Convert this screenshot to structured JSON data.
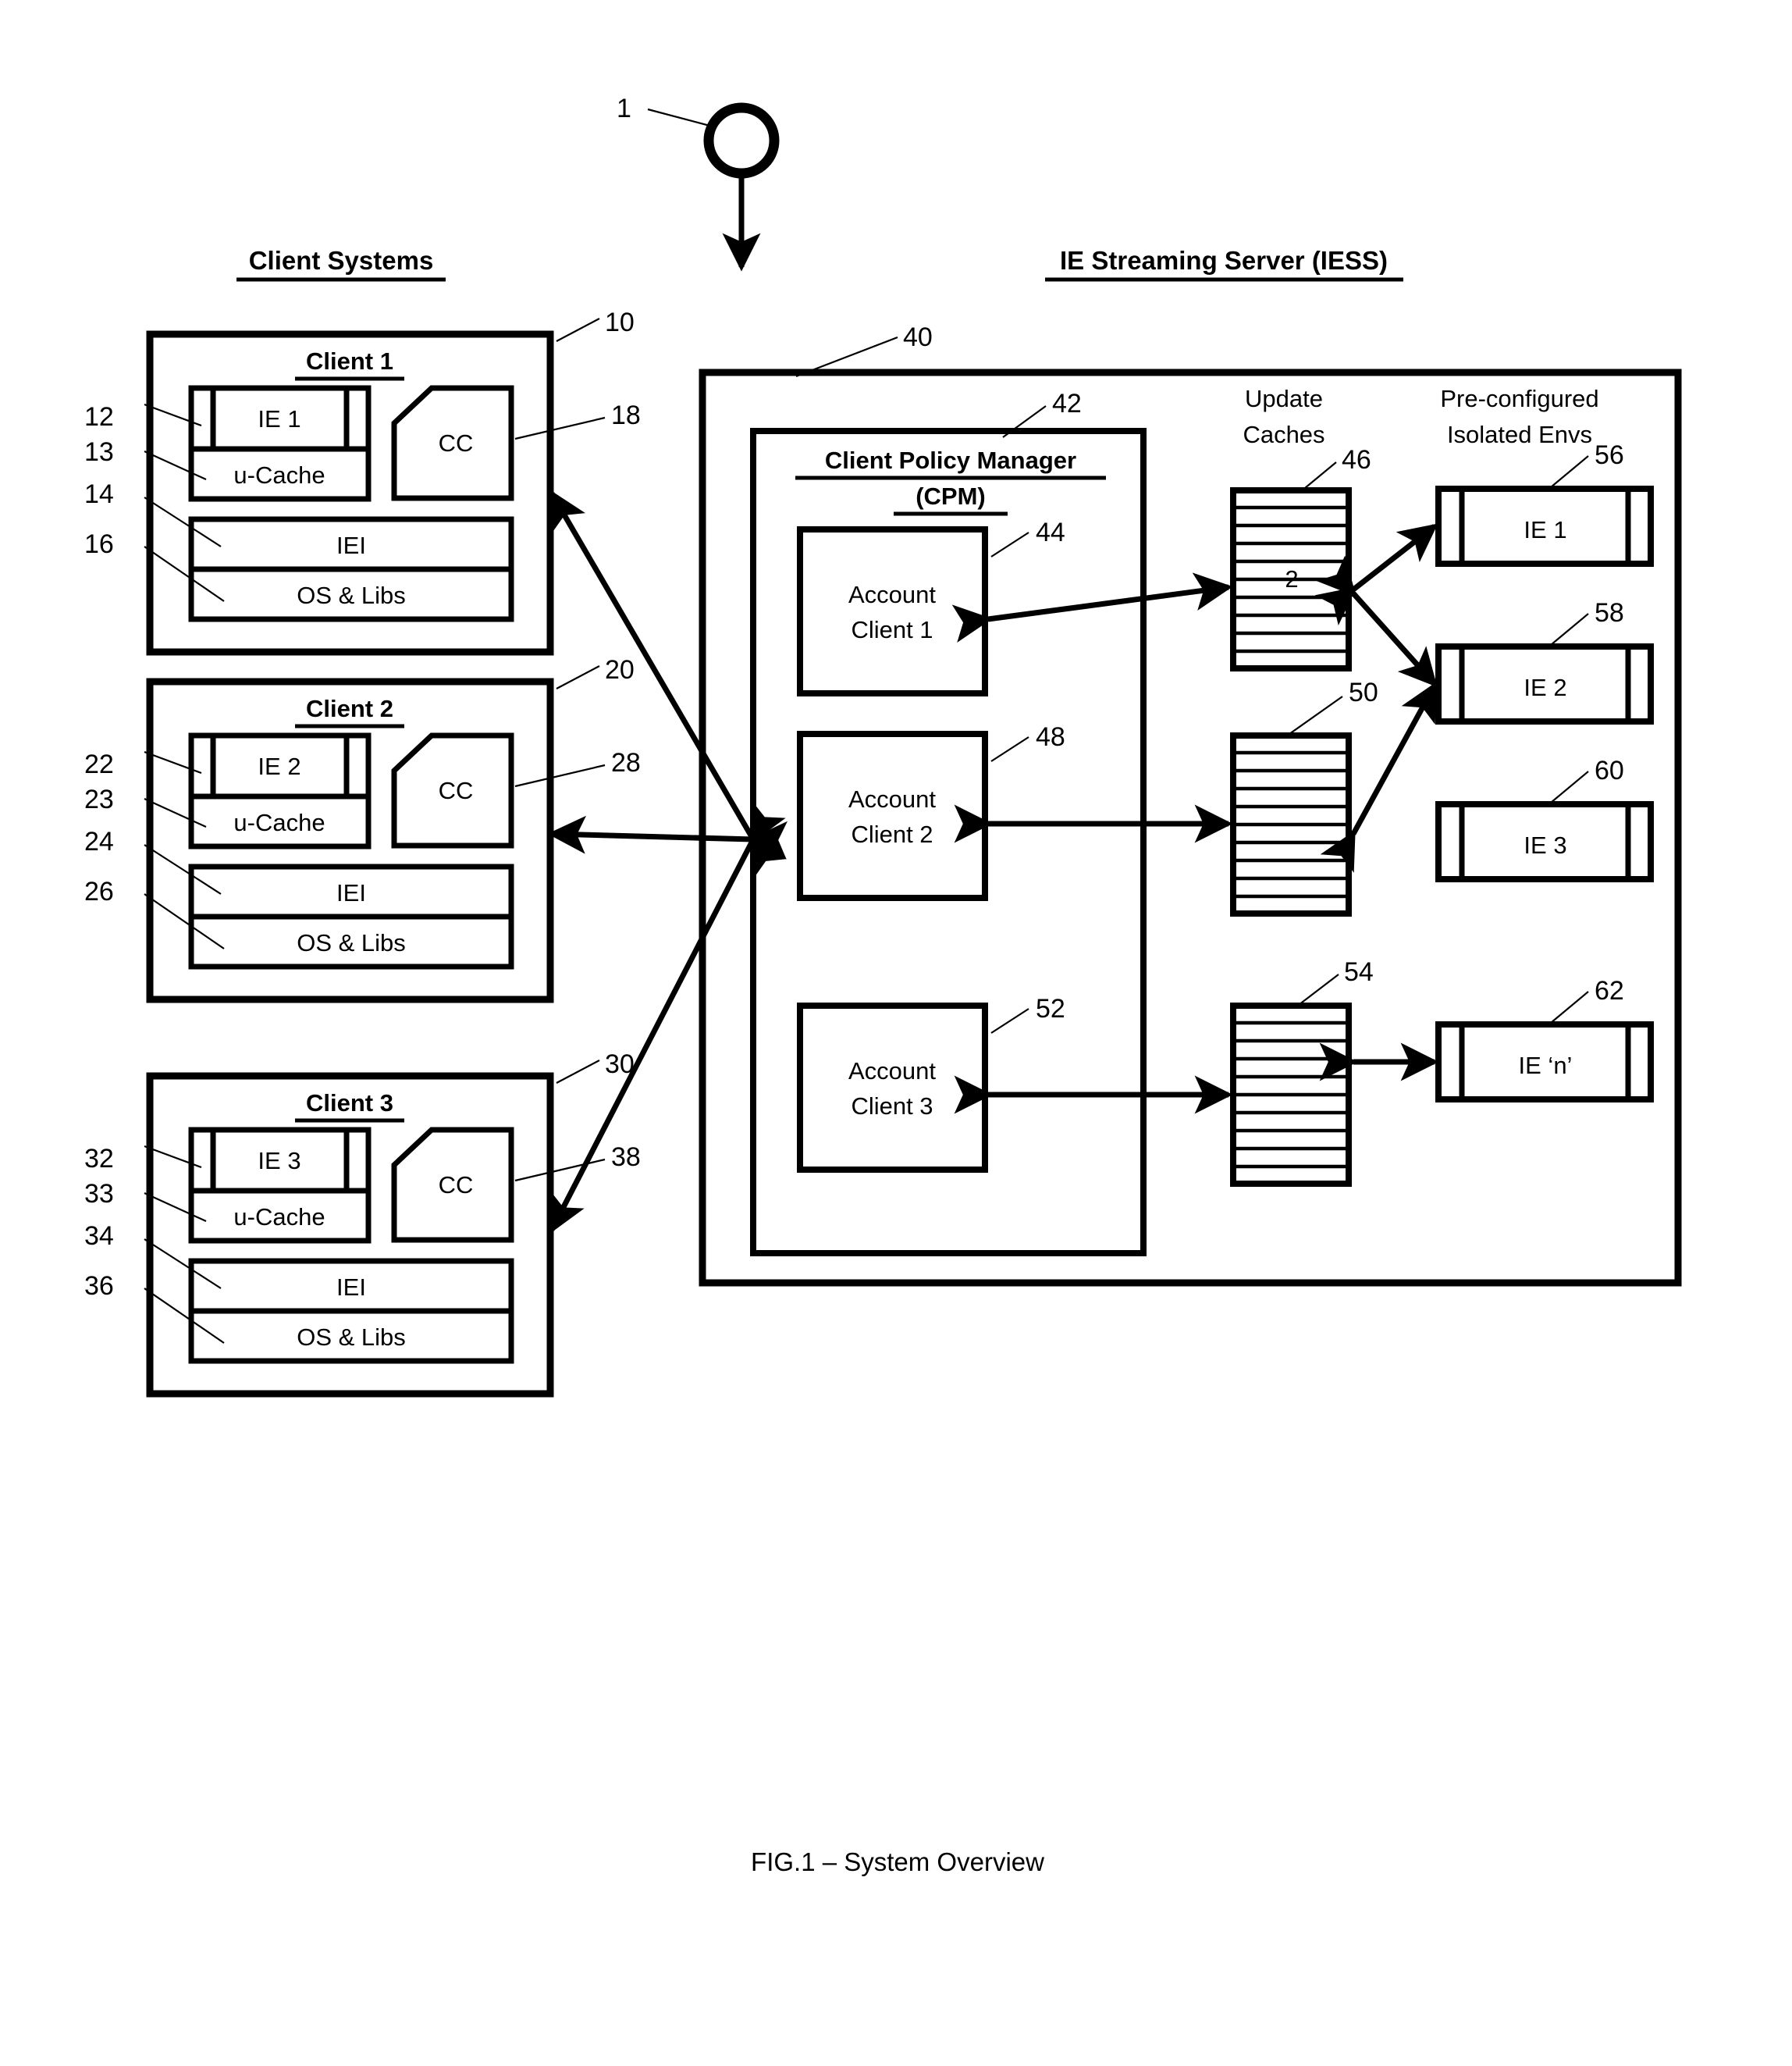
{
  "figure": {
    "caption": "FIG.1  – System Overview",
    "root_ref": "1"
  },
  "headers": {
    "left": "Client Systems",
    "right": "IE Streaming Server (IESS)"
  },
  "client_systems": [
    {
      "title": "Client 1",
      "ref_outer": "10",
      "ref_ie": "12",
      "ref_ucache": "13",
      "ref_iei": "14",
      "ref_os": "16",
      "ref_cc": "18",
      "ie_label": "IE 1",
      "ucache_label": "u-Cache",
      "iei_label": "IEI",
      "os_label": "OS & Libs",
      "cc_label": "CC"
    },
    {
      "title": "Client 2",
      "ref_outer": "20",
      "ref_ie": "22",
      "ref_ucache": "23",
      "ref_iei": "24",
      "ref_os": "26",
      "ref_cc": "28",
      "ie_label": "IE 2",
      "ucache_label": "u-Cache",
      "iei_label": "IEI",
      "os_label": "OS & Libs",
      "cc_label": "CC"
    },
    {
      "title": "Client 3",
      "ref_outer": "30",
      "ref_ie": "32",
      "ref_ucache": "33",
      "ref_iei": "34",
      "ref_os": "36",
      "ref_cc": "38",
      "ie_label": "IE 3",
      "ucache_label": "u-Cache",
      "iei_label": "IEI",
      "os_label": "OS & Libs",
      "cc_label": "CC"
    }
  ],
  "server": {
    "ref_outer": "40",
    "cpm": {
      "ref": "42",
      "title_line1": "Client Policy Manager",
      "title_line2": "(CPM)",
      "accounts": [
        {
          "ref": "44",
          "line1": "Account",
          "line2": "Client 1"
        },
        {
          "ref": "48",
          "line1": "Account",
          "line2": "Client  2"
        },
        {
          "ref": "52",
          "line1": "Account",
          "line2": "Client 3"
        }
      ]
    },
    "update_caches": {
      "header_line1": "Update",
      "header_line2": "Caches",
      "items": [
        {
          "ref": "46",
          "value": "2",
          "rows": 10
        },
        {
          "ref": "50",
          "value": "",
          "rows": 10
        },
        {
          "ref": "54",
          "value": "",
          "rows": 10
        }
      ]
    },
    "isolated_envs": {
      "header_line1": "Pre-configured",
      "header_line2": "Isolated Envs",
      "items": [
        {
          "ref": "56",
          "label": "IE 1"
        },
        {
          "ref": "58",
          "label": "IE 2"
        },
        {
          "ref": "60",
          "label": "IE 3"
        },
        {
          "ref": "62",
          "label": "IE ‘n’"
        }
      ]
    }
  }
}
